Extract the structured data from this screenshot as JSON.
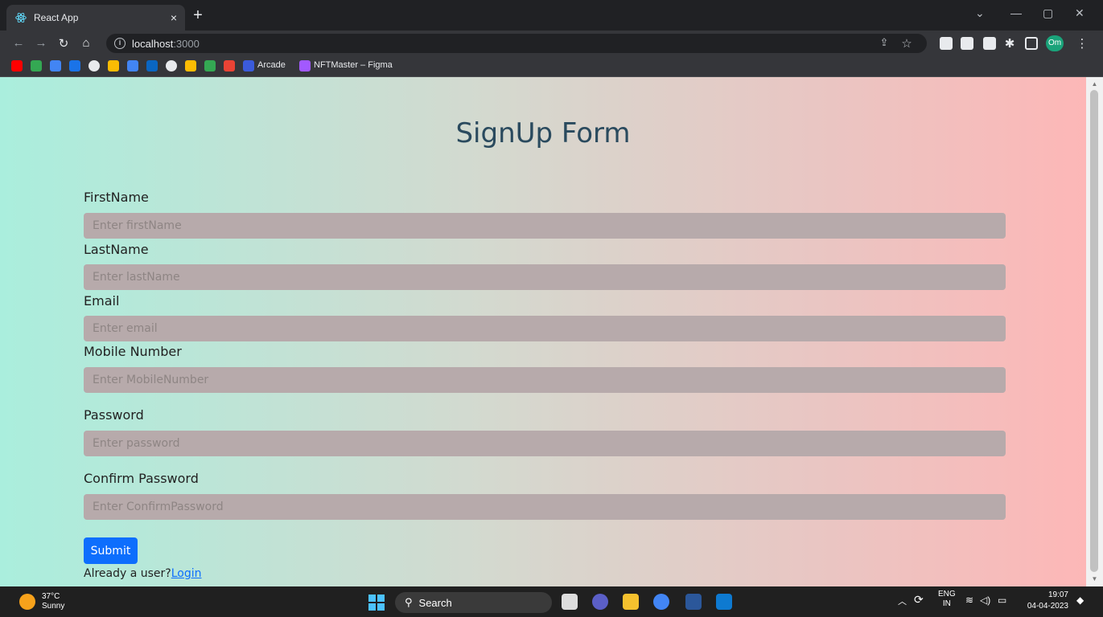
{
  "browser": {
    "tab_title": "React App",
    "tab_close": "×",
    "new_tab": "+",
    "url_host": "localhost",
    "url_port": ":3000",
    "win_minimize": "—",
    "win_restore": "▢",
    "win_close": "✕",
    "tab_list": "⌄",
    "profile_initials": "Om"
  },
  "bookmarks": {
    "items": [
      {
        "label": "Arcade"
      },
      {
        "label": "NFTMaster – Figma"
      }
    ]
  },
  "form": {
    "title": "SignUp Form",
    "fields": [
      {
        "label": "FirstName",
        "placeholder": "Enter firstName"
      },
      {
        "label": "LastName",
        "placeholder": "Enter lastName"
      },
      {
        "label": "Email",
        "placeholder": "Enter email"
      },
      {
        "label": "Mobile Number",
        "placeholder": "Enter MobileNumber"
      },
      {
        "label": "Password",
        "placeholder": "Enter password"
      },
      {
        "label": "Confirm Password",
        "placeholder": "Enter ConfirmPassword"
      }
    ],
    "submit_label": "Submit",
    "login_prompt": "Already a user?",
    "login_link": "Login"
  },
  "taskbar": {
    "weather_temp": "37°C",
    "weather_desc": "Sunny",
    "search_label": "Search",
    "lang_top": "ENG",
    "lang_bottom": "IN",
    "time": "19:07",
    "date": "04-04-2023"
  },
  "colors": {
    "accent": "#0d6efd",
    "title": "#2a4a5e",
    "input_bg": "#b7aaab"
  }
}
